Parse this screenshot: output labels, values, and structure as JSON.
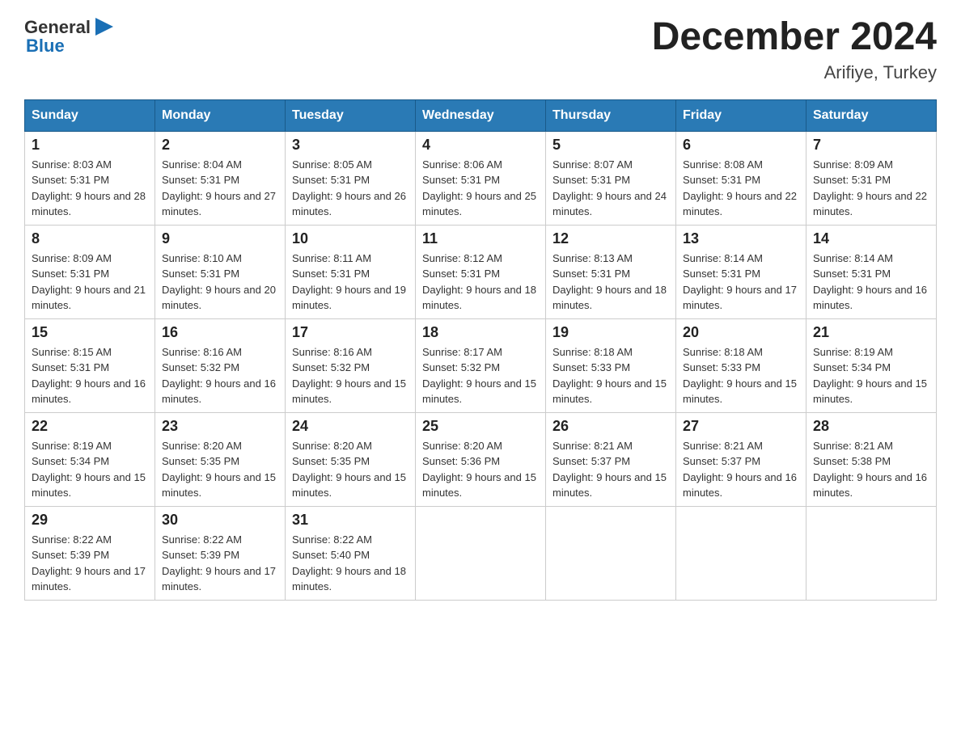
{
  "header": {
    "title": "December 2024",
    "subtitle": "Arifiye, Turkey"
  },
  "weekdays": [
    "Sunday",
    "Monday",
    "Tuesday",
    "Wednesday",
    "Thursday",
    "Friday",
    "Saturday"
  ],
  "weeks": [
    [
      {
        "day": "1",
        "sunrise": "Sunrise: 8:03 AM",
        "sunset": "Sunset: 5:31 PM",
        "daylight": "Daylight: 9 hours and 28 minutes."
      },
      {
        "day": "2",
        "sunrise": "Sunrise: 8:04 AM",
        "sunset": "Sunset: 5:31 PM",
        "daylight": "Daylight: 9 hours and 27 minutes."
      },
      {
        "day": "3",
        "sunrise": "Sunrise: 8:05 AM",
        "sunset": "Sunset: 5:31 PM",
        "daylight": "Daylight: 9 hours and 26 minutes."
      },
      {
        "day": "4",
        "sunrise": "Sunrise: 8:06 AM",
        "sunset": "Sunset: 5:31 PM",
        "daylight": "Daylight: 9 hours and 25 minutes."
      },
      {
        "day": "5",
        "sunrise": "Sunrise: 8:07 AM",
        "sunset": "Sunset: 5:31 PM",
        "daylight": "Daylight: 9 hours and 24 minutes."
      },
      {
        "day": "6",
        "sunrise": "Sunrise: 8:08 AM",
        "sunset": "Sunset: 5:31 PM",
        "daylight": "Daylight: 9 hours and 22 minutes."
      },
      {
        "day": "7",
        "sunrise": "Sunrise: 8:09 AM",
        "sunset": "Sunset: 5:31 PM",
        "daylight": "Daylight: 9 hours and 22 minutes."
      }
    ],
    [
      {
        "day": "8",
        "sunrise": "Sunrise: 8:09 AM",
        "sunset": "Sunset: 5:31 PM",
        "daylight": "Daylight: 9 hours and 21 minutes."
      },
      {
        "day": "9",
        "sunrise": "Sunrise: 8:10 AM",
        "sunset": "Sunset: 5:31 PM",
        "daylight": "Daylight: 9 hours and 20 minutes."
      },
      {
        "day": "10",
        "sunrise": "Sunrise: 8:11 AM",
        "sunset": "Sunset: 5:31 PM",
        "daylight": "Daylight: 9 hours and 19 minutes."
      },
      {
        "day": "11",
        "sunrise": "Sunrise: 8:12 AM",
        "sunset": "Sunset: 5:31 PM",
        "daylight": "Daylight: 9 hours and 18 minutes."
      },
      {
        "day": "12",
        "sunrise": "Sunrise: 8:13 AM",
        "sunset": "Sunset: 5:31 PM",
        "daylight": "Daylight: 9 hours and 18 minutes."
      },
      {
        "day": "13",
        "sunrise": "Sunrise: 8:14 AM",
        "sunset": "Sunset: 5:31 PM",
        "daylight": "Daylight: 9 hours and 17 minutes."
      },
      {
        "day": "14",
        "sunrise": "Sunrise: 8:14 AM",
        "sunset": "Sunset: 5:31 PM",
        "daylight": "Daylight: 9 hours and 16 minutes."
      }
    ],
    [
      {
        "day": "15",
        "sunrise": "Sunrise: 8:15 AM",
        "sunset": "Sunset: 5:31 PM",
        "daylight": "Daylight: 9 hours and 16 minutes."
      },
      {
        "day": "16",
        "sunrise": "Sunrise: 8:16 AM",
        "sunset": "Sunset: 5:32 PM",
        "daylight": "Daylight: 9 hours and 16 minutes."
      },
      {
        "day": "17",
        "sunrise": "Sunrise: 8:16 AM",
        "sunset": "Sunset: 5:32 PM",
        "daylight": "Daylight: 9 hours and 15 minutes."
      },
      {
        "day": "18",
        "sunrise": "Sunrise: 8:17 AM",
        "sunset": "Sunset: 5:32 PM",
        "daylight": "Daylight: 9 hours and 15 minutes."
      },
      {
        "day": "19",
        "sunrise": "Sunrise: 8:18 AM",
        "sunset": "Sunset: 5:33 PM",
        "daylight": "Daylight: 9 hours and 15 minutes."
      },
      {
        "day": "20",
        "sunrise": "Sunrise: 8:18 AM",
        "sunset": "Sunset: 5:33 PM",
        "daylight": "Daylight: 9 hours and 15 minutes."
      },
      {
        "day": "21",
        "sunrise": "Sunrise: 8:19 AM",
        "sunset": "Sunset: 5:34 PM",
        "daylight": "Daylight: 9 hours and 15 minutes."
      }
    ],
    [
      {
        "day": "22",
        "sunrise": "Sunrise: 8:19 AM",
        "sunset": "Sunset: 5:34 PM",
        "daylight": "Daylight: 9 hours and 15 minutes."
      },
      {
        "day": "23",
        "sunrise": "Sunrise: 8:20 AM",
        "sunset": "Sunset: 5:35 PM",
        "daylight": "Daylight: 9 hours and 15 minutes."
      },
      {
        "day": "24",
        "sunrise": "Sunrise: 8:20 AM",
        "sunset": "Sunset: 5:35 PM",
        "daylight": "Daylight: 9 hours and 15 minutes."
      },
      {
        "day": "25",
        "sunrise": "Sunrise: 8:20 AM",
        "sunset": "Sunset: 5:36 PM",
        "daylight": "Daylight: 9 hours and 15 minutes."
      },
      {
        "day": "26",
        "sunrise": "Sunrise: 8:21 AM",
        "sunset": "Sunset: 5:37 PM",
        "daylight": "Daylight: 9 hours and 15 minutes."
      },
      {
        "day": "27",
        "sunrise": "Sunrise: 8:21 AM",
        "sunset": "Sunset: 5:37 PM",
        "daylight": "Daylight: 9 hours and 16 minutes."
      },
      {
        "day": "28",
        "sunrise": "Sunrise: 8:21 AM",
        "sunset": "Sunset: 5:38 PM",
        "daylight": "Daylight: 9 hours and 16 minutes."
      }
    ],
    [
      {
        "day": "29",
        "sunrise": "Sunrise: 8:22 AM",
        "sunset": "Sunset: 5:39 PM",
        "daylight": "Daylight: 9 hours and 17 minutes."
      },
      {
        "day": "30",
        "sunrise": "Sunrise: 8:22 AM",
        "sunset": "Sunset: 5:39 PM",
        "daylight": "Daylight: 9 hours and 17 minutes."
      },
      {
        "day": "31",
        "sunrise": "Sunrise: 8:22 AM",
        "sunset": "Sunset: 5:40 PM",
        "daylight": "Daylight: 9 hours and 18 minutes."
      },
      null,
      null,
      null,
      null
    ]
  ]
}
